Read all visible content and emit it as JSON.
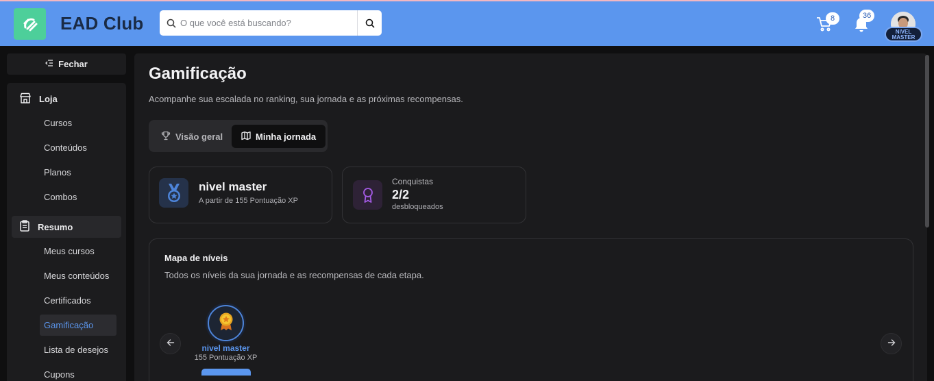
{
  "header": {
    "brand": "EAD Club",
    "search_placeholder": "O que você está buscando?",
    "cart_count": "8",
    "notifications_count": "36",
    "user_level_line1": "NIVEL",
    "user_level_line2": "MASTER"
  },
  "sidebar": {
    "close_label": "Fechar",
    "groups": [
      {
        "label": "Loja",
        "items": [
          "Cursos",
          "Conteúdos",
          "Planos",
          "Combos"
        ]
      },
      {
        "label": "Resumo",
        "items": [
          "Meus cursos",
          "Meus conteúdos",
          "Certificados",
          "Gamificação",
          "Lista de desejos",
          "Cupons"
        ]
      }
    ],
    "active_item": "Gamificação"
  },
  "main": {
    "title": "Gamificação",
    "subtitle": "Acompanhe sua escalada no ranking, sua jornada e as próximas recompensas.",
    "tabs": [
      {
        "label": "Visão geral"
      },
      {
        "label": "Minha jornada"
      }
    ],
    "level_card": {
      "title": "nivel master",
      "subtitle": "A partir de 155 Pontuação XP"
    },
    "achievements_card": {
      "label": "Conquistas",
      "value": "2/2",
      "subtitle": "desbloqueados"
    },
    "level_map": {
      "title": "Mapa de níveis",
      "subtitle": "Todos os níveis da sua jornada e as recompensas de cada etapa.",
      "levels": [
        {
          "name": "nivel master",
          "points": "155 Pontuação XP"
        }
      ]
    }
  },
  "colors": {
    "header_bg": "#5b96ee",
    "logo_bg": "#4dcf9a",
    "accent": "#5b96ee",
    "page_bg": "#0f0f10",
    "panel_bg": "#1b1b1d",
    "achievement_icon": "#a55be6"
  }
}
